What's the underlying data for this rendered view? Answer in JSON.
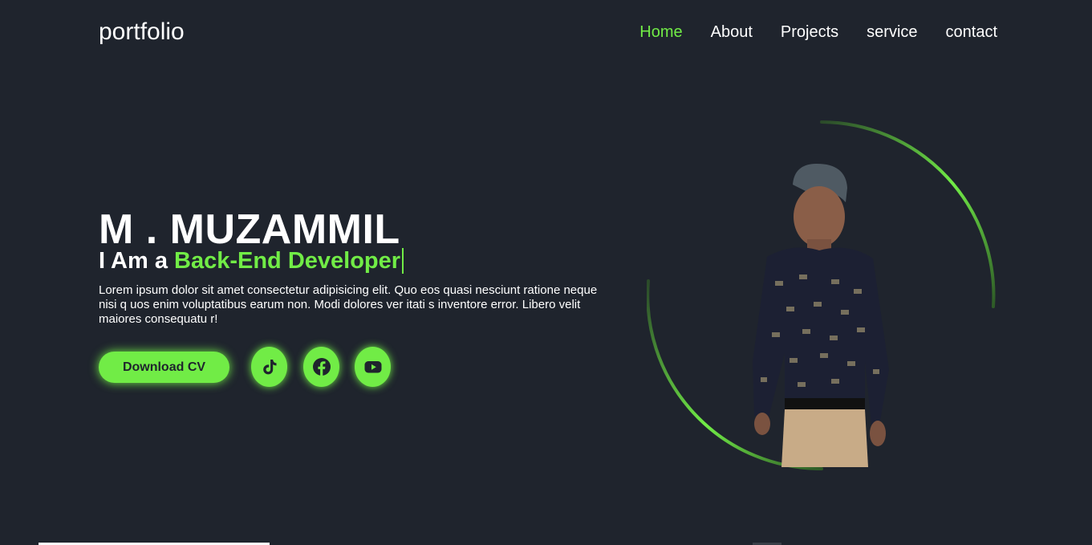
{
  "header": {
    "logo": "portfolio",
    "nav": [
      {
        "label": "Home",
        "active": true
      },
      {
        "label": "About",
        "active": false
      },
      {
        "label": "Projects",
        "active": false
      },
      {
        "label": "service",
        "active": false
      },
      {
        "label": "contact",
        "active": false
      }
    ]
  },
  "hero": {
    "name": "M . MUZAMMIL",
    "role_prefix": "I Am a",
    "role_typed": "Back-End Developer",
    "description": "Lorem ipsum dolor sit amet consectetur adipisicing elit. Quo eos quasi nesciunt ratione neque nisi q uos enim voluptatibus earum non. Modi dolores ver itati s inventore error. Libero velit maiores consequatu r!",
    "cv_button": "Download CV",
    "social": [
      {
        "icon": "tiktok-icon"
      },
      {
        "icon": "facebook-icon"
      },
      {
        "icon": "youtube-icon"
      }
    ]
  },
  "colors": {
    "background": "#1f242d",
    "accent": "#71ec46",
    "text": "#ffffff"
  }
}
